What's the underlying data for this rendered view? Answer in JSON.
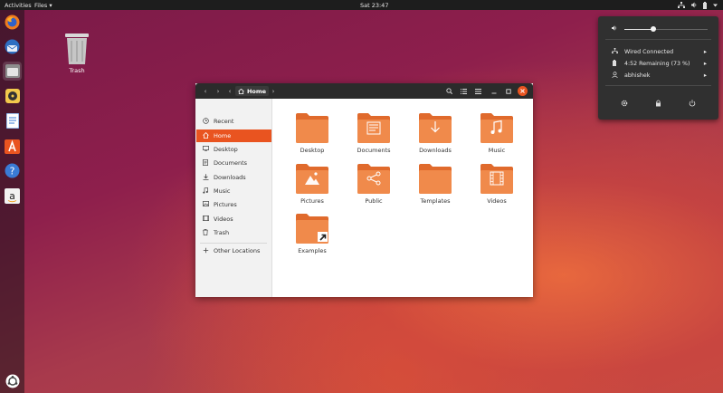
{
  "topbar": {
    "activities": "Activities",
    "app_menu": "Files ▾",
    "clock": "Sat 23:47"
  },
  "desktop": {
    "trash_label": "Trash"
  },
  "window": {
    "breadcrumb": "Home",
    "sidebar": [
      {
        "label": "Recent",
        "icon": "clock-icon"
      },
      {
        "label": "Home",
        "icon": "home-icon",
        "selected": true
      },
      {
        "label": "Desktop",
        "icon": "desktop-icon"
      },
      {
        "label": "Documents",
        "icon": "document-icon"
      },
      {
        "label": "Downloads",
        "icon": "download-icon"
      },
      {
        "label": "Music",
        "icon": "music-icon"
      },
      {
        "label": "Pictures",
        "icon": "picture-icon"
      },
      {
        "label": "Videos",
        "icon": "video-icon"
      },
      {
        "label": "Trash",
        "icon": "trash-icon"
      },
      {
        "label": "Other Locations",
        "icon": "plus-icon"
      }
    ],
    "folders": [
      {
        "label": "Desktop",
        "emblem": "none"
      },
      {
        "label": "Documents",
        "emblem": "document"
      },
      {
        "label": "Downloads",
        "emblem": "download"
      },
      {
        "label": "Music",
        "emblem": "music"
      },
      {
        "label": "Pictures",
        "emblem": "picture"
      },
      {
        "label": "Public",
        "emblem": "share"
      },
      {
        "label": "Templates",
        "emblem": "none"
      },
      {
        "label": "Videos",
        "emblem": "film"
      },
      {
        "label": "Examples",
        "emblem": "link"
      }
    ]
  },
  "popover": {
    "volume_fraction": 0.35,
    "network": "Wired Connected",
    "battery": "4:52 Remaining (73 %)",
    "user": "abhishek"
  },
  "colors": {
    "accent": "#e95420",
    "folder": "#f08a4b",
    "folder_dark": "#e06a2c"
  }
}
